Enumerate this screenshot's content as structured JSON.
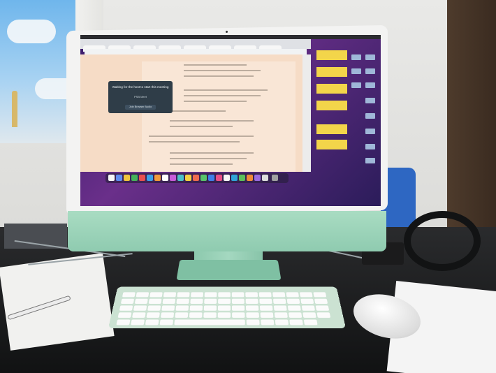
{
  "scene": {
    "description_type": "photo"
  },
  "screen": {
    "meeting_message": "Waiting for the host to start this meeting",
    "meeting_name": "PSB Meet",
    "meeting_button": "Join Browser Audio"
  },
  "colors": {
    "monitor_chin": "#9fd3b9",
    "stand": "#8cc9ad",
    "wallpaper": "#5a2a80",
    "desk": "#1c1d1f"
  }
}
